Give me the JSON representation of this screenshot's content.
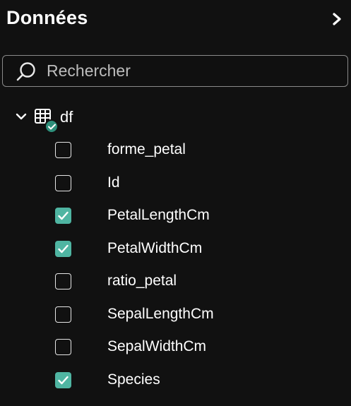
{
  "header": {
    "title": "Données",
    "collapse_icon": "chevron-right-double-icon"
  },
  "search": {
    "placeholder": "Rechercher",
    "value": "",
    "icon": "search-icon"
  },
  "tree": {
    "node_label": "df",
    "expanded": true,
    "icon": "table-icon",
    "badge_color": "#2e8f7b"
  },
  "fields": [
    {
      "label": "forme_petal",
      "checked": false
    },
    {
      "label": "Id",
      "checked": false
    },
    {
      "label": "PetalLengthCm",
      "checked": true
    },
    {
      "label": "PetalWidthCm",
      "checked": true
    },
    {
      "label": "ratio_petal",
      "checked": false
    },
    {
      "label": "SepalLengthCm",
      "checked": false
    },
    {
      "label": "SepalWidthCm",
      "checked": false
    },
    {
      "label": "Species",
      "checked": true
    }
  ],
  "colors": {
    "background": "#111111",
    "accent": "#4fb5a2",
    "text": "#ffffff"
  }
}
